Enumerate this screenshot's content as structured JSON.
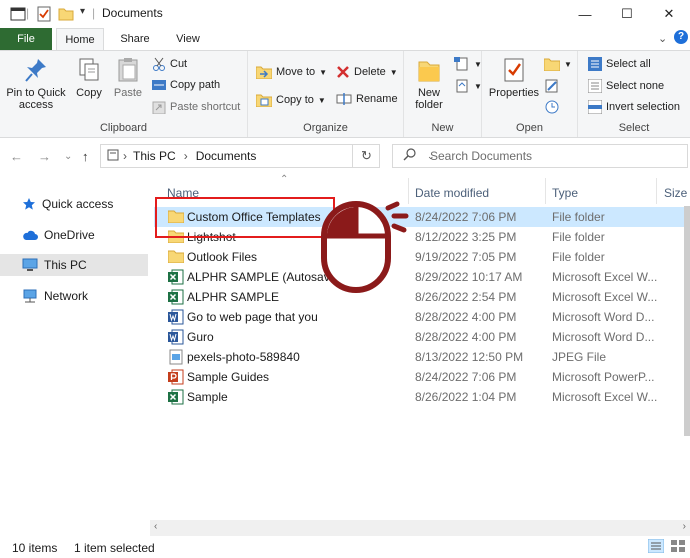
{
  "window": {
    "title": "Documents",
    "controls": {
      "minimize": "—",
      "maximize": "☐",
      "close": "✕"
    }
  },
  "tabs": [
    {
      "label": "File"
    },
    {
      "label": "Home"
    },
    {
      "label": "Share"
    },
    {
      "label": "View"
    }
  ],
  "ribbon": {
    "clipboard": {
      "label": "Clipboard",
      "pin_line1": "Pin to Quick",
      "pin_line2": "access",
      "copy": "Copy",
      "paste": "Paste",
      "cut": "Cut",
      "copy_path": "Copy path",
      "paste_shortcut": "Paste shortcut"
    },
    "organize": {
      "label": "Organize",
      "move_to": "Move to",
      "copy_to": "Copy to",
      "delete": "Delete",
      "rename": "Rename"
    },
    "new": {
      "label": "New",
      "new_line1": "New",
      "new_line2": "folder"
    },
    "open": {
      "label": "Open",
      "properties": "Properties"
    },
    "select": {
      "label": "Select",
      "select_all": "Select all",
      "select_none": "Select none",
      "invert_selection": "Invert selection"
    }
  },
  "address": {
    "path": [
      "This PC",
      "Documents"
    ],
    "separator": "›",
    "search_placeholder": "Search Documents"
  },
  "navpane": {
    "items": [
      {
        "label": "Quick access",
        "icon": "star-icon"
      },
      {
        "label": "OneDrive",
        "icon": "cloud-icon"
      },
      {
        "label": "This PC",
        "icon": "monitor-icon",
        "selected": true
      },
      {
        "label": "Network",
        "icon": "network-icon"
      }
    ]
  },
  "columns": {
    "name": "Name",
    "date": "Date modified",
    "type": "Type",
    "size": "Size"
  },
  "files": [
    {
      "name": "Custom Office Templates",
      "date": "8/24/2022 7:06 PM",
      "type": "File folder",
      "icon": "folder-icon",
      "selected": true
    },
    {
      "name": "Lightshot",
      "date": "8/12/2022 3:25 PM",
      "type": "File folder",
      "icon": "folder-icon"
    },
    {
      "name": "Outlook Files",
      "date": "9/19/2022 7:05 PM",
      "type": "File folder",
      "icon": "folder-icon"
    },
    {
      "name": "ALPHR SAMPLE (Autosaved)",
      "date": "8/29/2022 10:17 AM",
      "type": "Microsoft Excel W...",
      "icon": "excel-icon"
    },
    {
      "name": "ALPHR SAMPLE",
      "date": "8/26/2022 2:54 PM",
      "type": "Microsoft Excel W...",
      "icon": "excel-icon"
    },
    {
      "name": "Go to web page that you",
      "date": "8/28/2022 4:00 PM",
      "type": "Microsoft Word D...",
      "icon": "word-icon"
    },
    {
      "name": "Guro",
      "date": "8/28/2022 4:00 PM",
      "type": "Microsoft Word D...",
      "icon": "word-icon"
    },
    {
      "name": "pexels-photo-589840",
      "date": "8/13/2022 12:50 PM",
      "type": "JPEG File",
      "icon": "image-icon"
    },
    {
      "name": "Sample Guides",
      "date": "8/24/2022 7:06 PM",
      "type": "Microsoft PowerP...",
      "icon": "powerpoint-icon"
    },
    {
      "name": "Sample",
      "date": "8/26/2022 1:04 PM",
      "type": "Microsoft Excel W...",
      "icon": "excel-icon"
    }
  ],
  "status": {
    "items_count": "10 items",
    "selection": "1 item selected"
  },
  "colors": {
    "file_tab": "#2e6b32",
    "selection": "#cce8ff",
    "highlight": "#e31c1c",
    "mouse": "#8b1a1a"
  }
}
